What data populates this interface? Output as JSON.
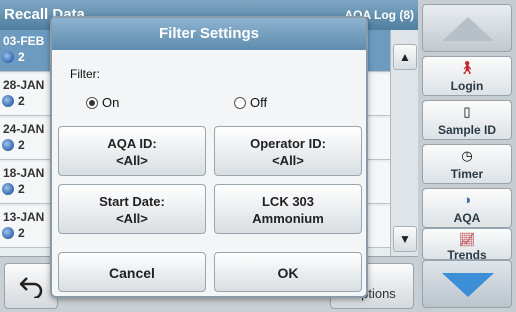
{
  "background": {
    "title": "Recall Data",
    "header_right": "AQA Log (8)",
    "rows": [
      {
        "date": "03-FEB",
        "num": "2"
      },
      {
        "date": "28-JAN",
        "num": "2"
      },
      {
        "date": "24-JAN",
        "num": "2"
      },
      {
        "date": "18-JAN",
        "num": "2"
      },
      {
        "date": "13-JAN",
        "num": "2"
      }
    ],
    "options_label": "Options"
  },
  "sidebar": {
    "login": "Login",
    "sample_id": "Sample ID",
    "timer": "Timer",
    "aqa": "AQA",
    "trends": "Trends"
  },
  "dialog": {
    "title": "Filter Settings",
    "filter_label": "Filter:",
    "radio_on": "On",
    "radio_off": "Off",
    "selected": "On",
    "aqa_id": {
      "label": "AQA ID:",
      "value": "<All>"
    },
    "operator_id": {
      "label": "Operator ID:",
      "value": "<All>"
    },
    "start_date": {
      "label": "Start Date:",
      "value": "<All>"
    },
    "test": {
      "line1": "LCK 303",
      "line2": "Ammonium"
    },
    "cancel": "Cancel",
    "ok": "OK"
  },
  "colors": {
    "title_bar": "#6f99ba",
    "accent_blue": "#3c8fd6"
  }
}
